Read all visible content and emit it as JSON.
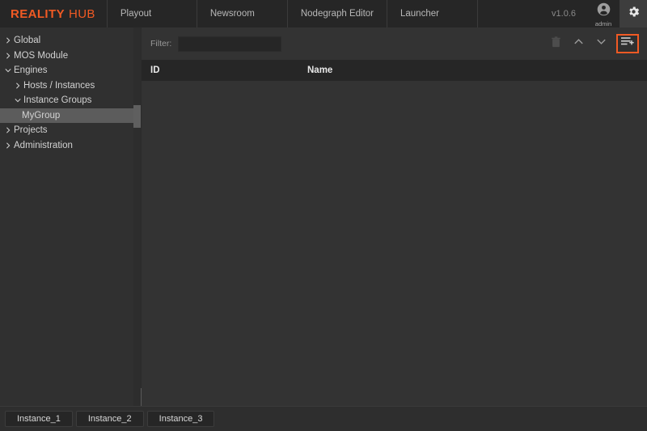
{
  "header": {
    "logo_primary": "REALITY",
    "logo_secondary": "HUB",
    "nav_items": [
      {
        "label": "Playout"
      },
      {
        "label": "Newsroom"
      },
      {
        "label": "Nodegraph Editor"
      },
      {
        "label": "Launcher"
      }
    ],
    "version": "v1.0.6",
    "user_name": "admin",
    "user_icon": "user-avatar-icon",
    "settings_icon": "gear-icon"
  },
  "sidebar": {
    "items": [
      {
        "label": "Global",
        "level": 0,
        "state": "collapsed",
        "selected": false
      },
      {
        "label": "MOS Module",
        "level": 0,
        "state": "collapsed",
        "selected": false
      },
      {
        "label": "Engines",
        "level": 0,
        "state": "expanded",
        "selected": false
      },
      {
        "label": "Hosts / Instances",
        "level": 1,
        "state": "collapsed",
        "selected": false
      },
      {
        "label": "Instance Groups",
        "level": 1,
        "state": "expanded",
        "selected": false
      },
      {
        "label": "MyGroup",
        "level": 2,
        "state": "leaf",
        "selected": true
      },
      {
        "label": "Projects",
        "level": 0,
        "state": "collapsed",
        "selected": false
      },
      {
        "label": "Administration",
        "level": 0,
        "state": "collapsed",
        "selected": false
      }
    ]
  },
  "toolbar": {
    "filter_label": "Filter:",
    "filter_value": "",
    "filter_placeholder": "",
    "buttons": [
      {
        "name": "delete-button",
        "icon": "trash-icon",
        "enabled": false
      },
      {
        "name": "move-up-button",
        "icon": "chevron-up-icon",
        "enabled": true
      },
      {
        "name": "move-down-button",
        "icon": "chevron-down-icon",
        "enabled": true
      },
      {
        "name": "add-instance-button",
        "icon": "add-list-item-icon",
        "enabled": true,
        "highlighted": true
      }
    ]
  },
  "table": {
    "columns": [
      "ID",
      "Name"
    ],
    "rows": []
  },
  "footer": {
    "instance_tabs": [
      {
        "label": "Instance_1"
      },
      {
        "label": "Instance_2"
      },
      {
        "label": "Instance_3"
      }
    ]
  },
  "colors": {
    "accent": "#f15a24",
    "header_bg": "#262626",
    "sidebar_bg": "#303030",
    "main_bg": "#333333",
    "selection_bg": "#5c5c5c",
    "footer_bg": "#2e2e2e"
  }
}
